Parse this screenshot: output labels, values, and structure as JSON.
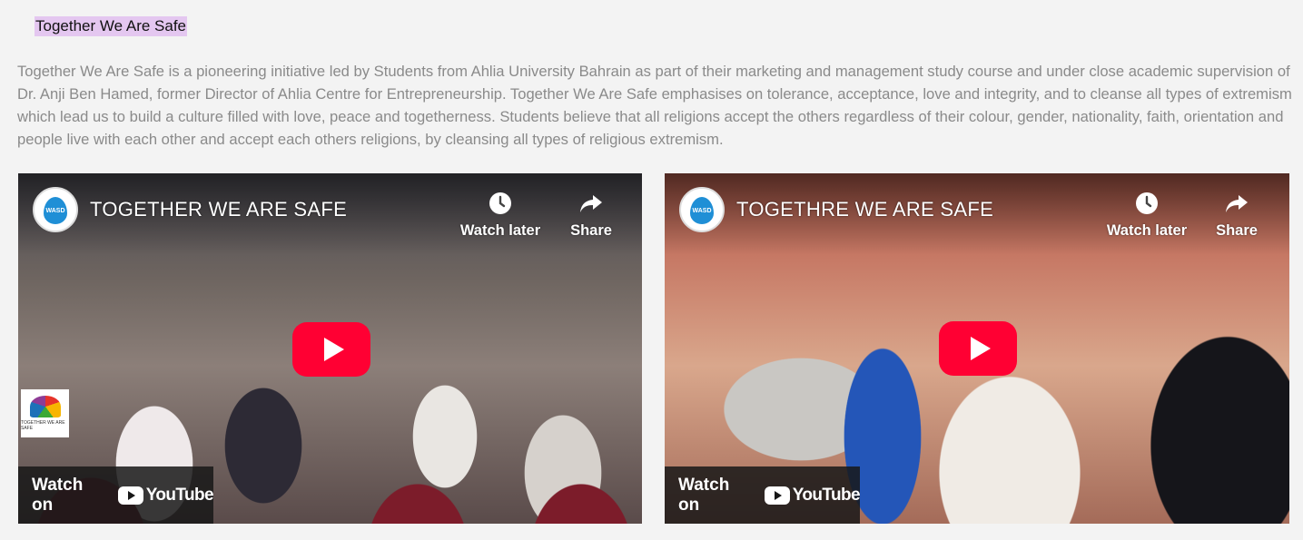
{
  "section": {
    "heading": "Together We Are Safe",
    "intro": "Together We Are Safe is a pioneering initiative led by Students from Ahlia University Bahrain as part of their marketing and management study course and under close academic supervision of Dr. Anji Ben Hamed, former Director of Ahlia Centre for Entrepreneurship. Together We Are Safe emphasises on tolerance, acceptance, love and integrity, and to cleanse all types of extremism which lead us to build a culture filled with love, peace and togetherness. Students believe that all religions accept the others regardless of their colour, gender, nationality, faith, orientation and people live with each other and accept each others religions, by cleansing all types of religious extremism."
  },
  "videos": [
    {
      "title": "TOGETHER WE ARE SAFE",
      "channel_logo_text": "WASD",
      "watch_later_label": "Watch later",
      "share_label": "Share",
      "watch_on_label": "Watch on",
      "youtube_label": "YouTube",
      "badge_text": "TOGETHER WE ARE SAFE"
    },
    {
      "title": "TOGETHRE WE ARE SAFE",
      "channel_logo_text": "WASD",
      "watch_later_label": "Watch later",
      "share_label": "Share",
      "watch_on_label": "Watch on",
      "youtube_label": "YouTube"
    }
  ],
  "colors": {
    "play_button": "#ff0033",
    "heading_highlight": "#e4c7f0",
    "intro_text": "#8a8a8a",
    "page_background": "#f3f3f3"
  },
  "icons": [
    "clock-icon",
    "share-icon",
    "play-icon",
    "youtube-logo-icon",
    "wasd-logo-icon"
  ]
}
